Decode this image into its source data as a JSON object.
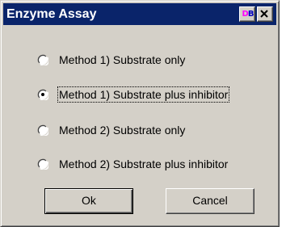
{
  "window": {
    "title": "Enzyme Assay",
    "title_bar_color": "#0a246a",
    "face_color": "#d4d0c8",
    "titlebar_buttons": [
      {
        "name": "db-icon",
        "glyph_d": "D",
        "glyph_b": "B"
      },
      {
        "name": "close-icon"
      }
    ]
  },
  "options": [
    {
      "label": "Method 1) Substrate only",
      "checked": false,
      "focused": false
    },
    {
      "label": "Method 1) Substrate plus inhibitor",
      "checked": true,
      "focused": true
    },
    {
      "label": "Method 2) Substrate only",
      "checked": false,
      "focused": false
    },
    {
      "label": "Method 2) Substrate plus inhibitor",
      "checked": false,
      "focused": false
    }
  ],
  "buttons": {
    "ok_label": "Ok",
    "cancel_label": "Cancel"
  }
}
